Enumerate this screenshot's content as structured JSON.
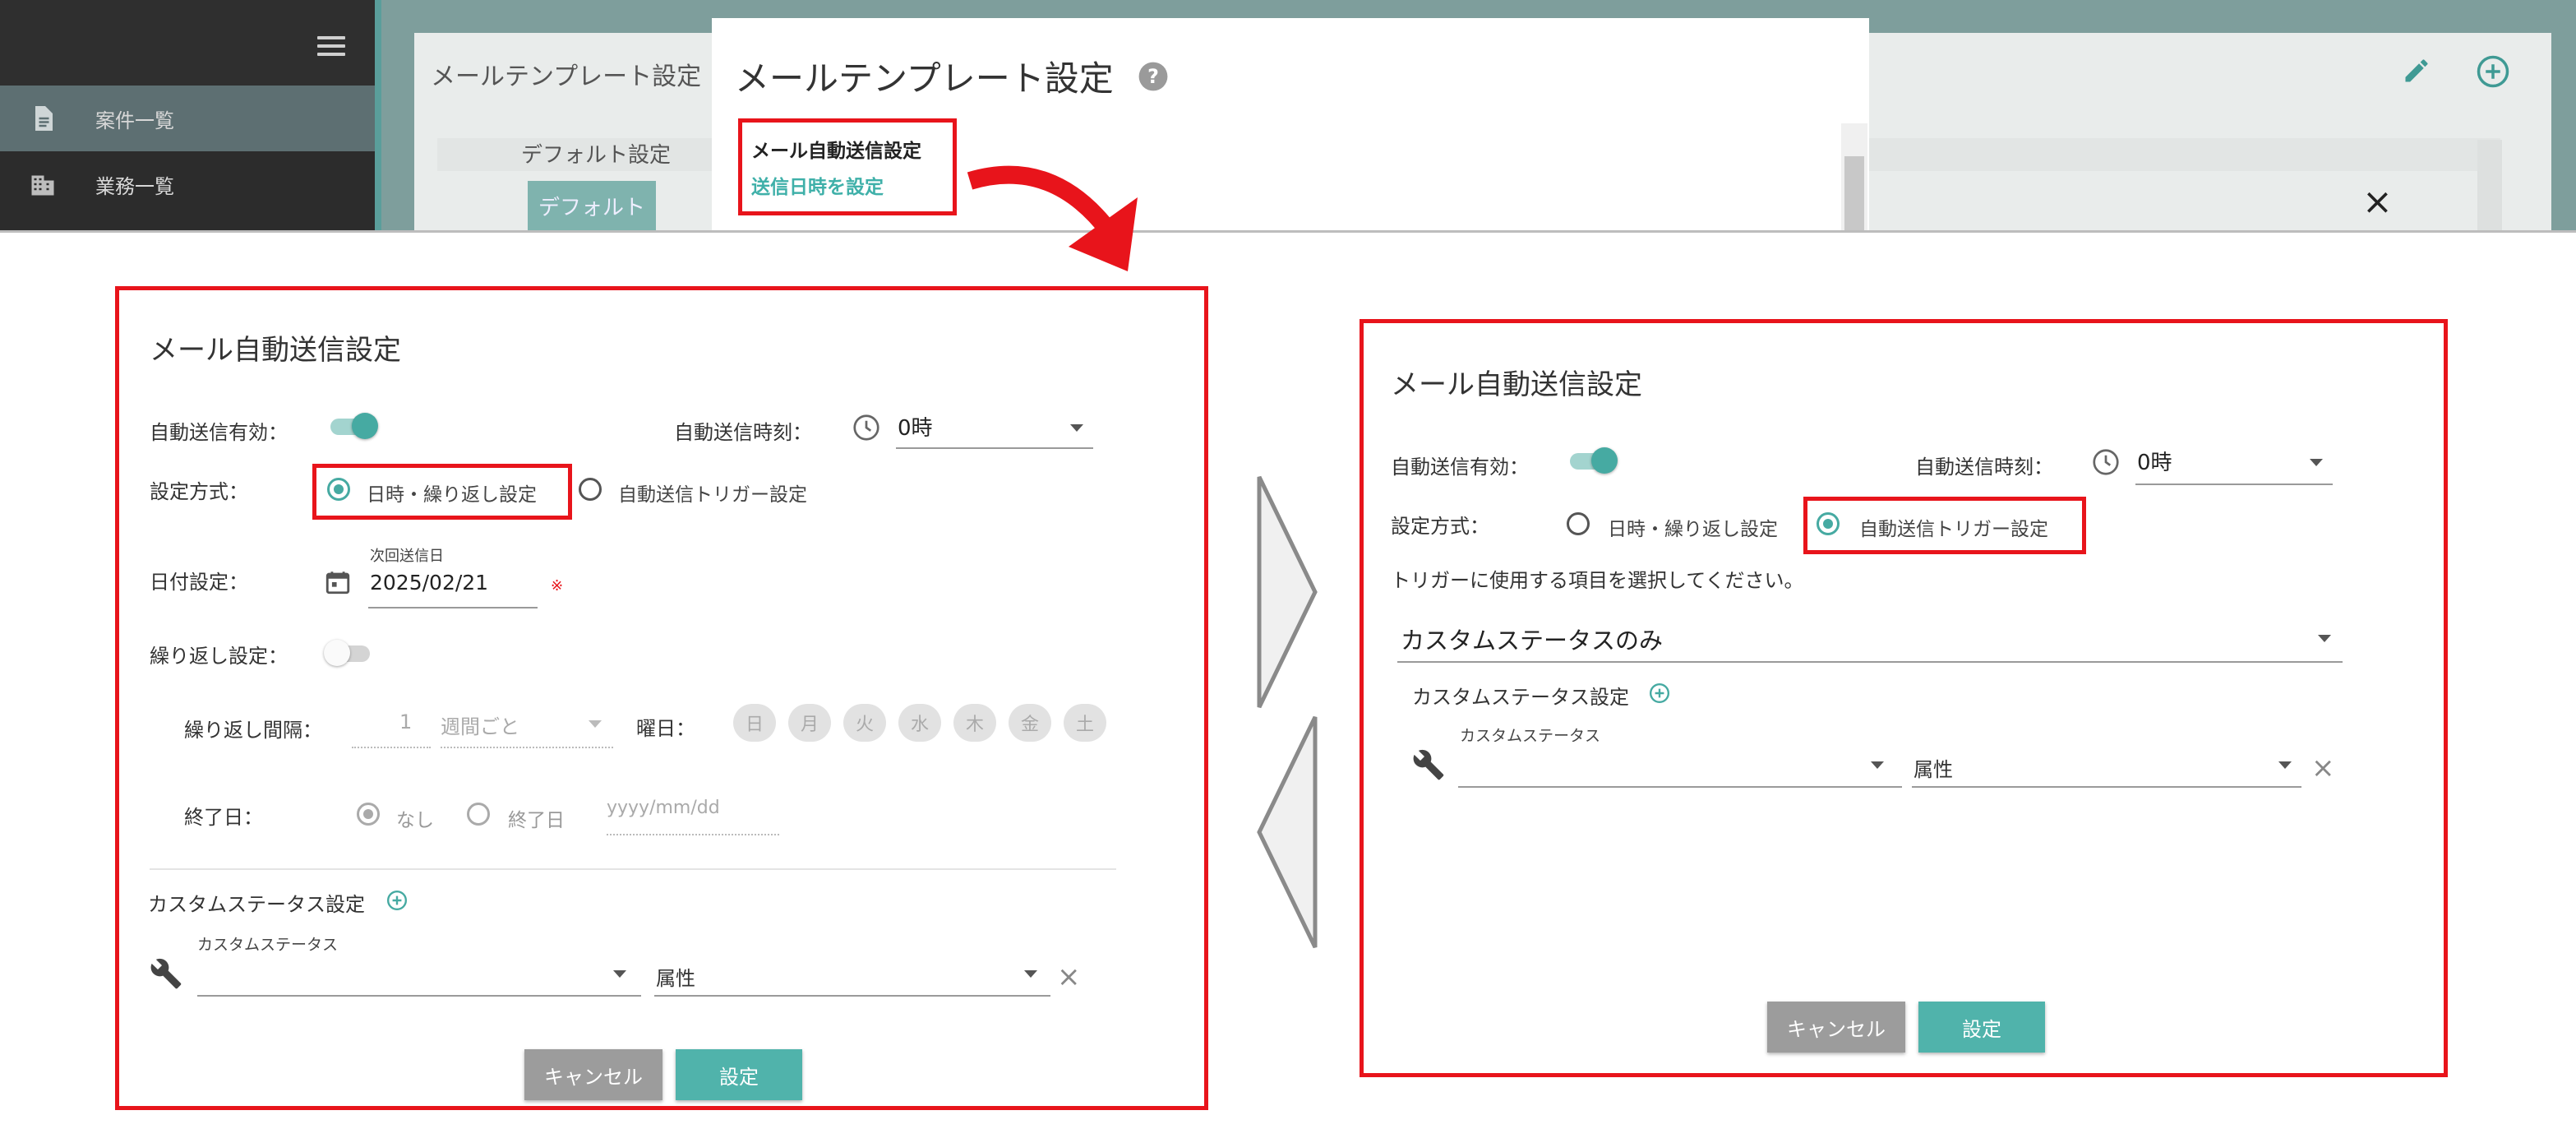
{
  "sidebar": {
    "items": [
      {
        "label": "案件一覧",
        "icon": "document-icon"
      },
      {
        "label": "業務一覧",
        "icon": "building-icon"
      }
    ]
  },
  "background": {
    "card_title": "メールテンプレート設定",
    "default_column": "デフォルト設定",
    "default_button": "デフォルト",
    "close_glyph": "×"
  },
  "modal": {
    "title": "メールテンプレート設定",
    "nav_title": "メール自動送信設定",
    "nav_link": "送信日時を設定"
  },
  "left": {
    "title": "メール自動送信設定",
    "enable_label": "自動送信有効：",
    "time_label": "自動送信時刻：",
    "time_value": "0時",
    "method_label": "設定方式：",
    "option_datetime": "日時・繰り返し設定",
    "option_trigger": "自動送信トリガー設定",
    "date_label": "日付設定：",
    "next_send_label": "次回送信日",
    "next_send_value": "2025/02/21",
    "required_mark": "※",
    "repeat_label": "繰り返し設定：",
    "interval_label": "繰り返し間隔：",
    "interval_value": "1",
    "interval_unit": "週間ごと",
    "weekday_label": "曜日：",
    "weekdays": [
      "日",
      "月",
      "火",
      "水",
      "木",
      "金",
      "土"
    ],
    "end_label": "終了日：",
    "end_none": "なし",
    "end_date": "終了日",
    "end_placeholder": "yyyy/mm/dd",
    "custom_status_title": "カスタムステータス設定",
    "custom_status_field": "カスタムステータス",
    "attribute_field": "属性",
    "clear_glyph": "×",
    "cancel_button": "キャンセル",
    "ok_button": "設定"
  },
  "right": {
    "title": "メール自動送信設定",
    "enable_label": "自動送信有効：",
    "time_label": "自動送信時刻：",
    "time_value": "0時",
    "method_label": "設定方式：",
    "option_datetime": "日時・繰り返し設定",
    "option_trigger": "自動送信トリガー設定",
    "trigger_instruction": "トリガーに使用する項目を選択してください。",
    "trigger_select_value": "カスタムステータスのみ",
    "custom_status_title": "カスタムステータス設定",
    "custom_status_field": "カスタムステータス",
    "attribute_field": "属性",
    "clear_glyph": "×",
    "cancel_button": "キャンセル",
    "ok_button": "設定"
  },
  "colors": {
    "accent": "#46aaa2",
    "highlight": "#e8141b"
  }
}
